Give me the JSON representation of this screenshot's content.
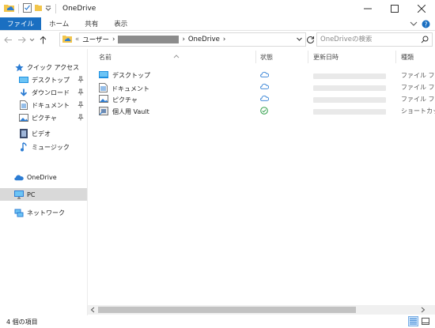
{
  "window": {
    "title": "OneDrive"
  },
  "ribbon": {
    "tabs": [
      "ファイル",
      "ホーム",
      "共有",
      "表示"
    ]
  },
  "address": {
    "crumbs": [
      "ユーザー",
      "OneDrive"
    ],
    "search_placeholder": "OneDriveの検索"
  },
  "navpane": {
    "quick_access": "クイック アクセス",
    "quick_items": [
      {
        "label": "デスクトップ",
        "icon": "desktop-icon",
        "pinned": true
      },
      {
        "label": "ダウンロード",
        "icon": "download-icon",
        "pinned": true
      },
      {
        "label": "ドキュメント",
        "icon": "document-icon",
        "pinned": true
      },
      {
        "label": "ピクチャ",
        "icon": "picture-icon",
        "pinned": true
      },
      {
        "label": "ビデオ",
        "icon": "video-icon",
        "pinned": false
      },
      {
        "label": "ミュージック",
        "icon": "music-icon",
        "pinned": false
      }
    ],
    "onedrive": "OneDrive",
    "pc": "PC",
    "network": "ネットワーク"
  },
  "columns": {
    "name": "名前",
    "status": "状態",
    "modified": "更新日時",
    "type": "種類"
  },
  "files": [
    {
      "name": "デスクトップ",
      "icon": "desktop-folder-icon",
      "status": "cloud-icon",
      "type": "ファイル フォル"
    },
    {
      "name": "ドキュメント",
      "icon": "documents-folder-icon",
      "status": "cloud-icon",
      "type": "ファイル フォル"
    },
    {
      "name": "ピクチャ",
      "icon": "pictures-folder-icon",
      "status": "cloud-icon",
      "type": "ファイル フォル"
    },
    {
      "name": "個人用 Vault",
      "icon": "vault-shortcut-icon",
      "status": "synced-check-icon",
      "type": "ショートカット"
    }
  ],
  "status": {
    "item_count": "4 個の項目"
  },
  "colors": {
    "accent": "#1a6fc1",
    "folder": "#f2c54b",
    "cloud": "#2b7cd3",
    "synced": "#2e9e48"
  }
}
